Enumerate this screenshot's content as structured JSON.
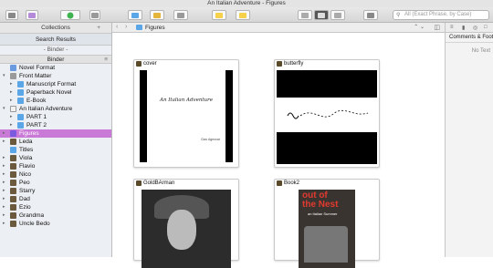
{
  "window_title": "An Italian Adventure - Figures",
  "toolbar": {
    "search_placeholder": "All (Exact Phrase, by Case)"
  },
  "sidebar": {
    "collections_label": "Collections",
    "search_results_label": "Search Results",
    "binder_tab_label": "- Binder -",
    "binder_label": "Binder",
    "tree": [
      {
        "label": "Novel Format",
        "depth": 0,
        "icon": "format",
        "arrow": ""
      },
      {
        "label": "Front Matter",
        "depth": 0,
        "icon": "folder-doc",
        "arrow": "▾"
      },
      {
        "label": "Manuscript Format",
        "depth": 1,
        "icon": "folder",
        "arrow": "▸"
      },
      {
        "label": "Paperback Novel",
        "depth": 1,
        "icon": "folder",
        "arrow": "▸"
      },
      {
        "label": "E-Book",
        "depth": 1,
        "icon": "folder",
        "arrow": "▸"
      },
      {
        "label": "An Italian Adventure",
        "depth": 0,
        "icon": "doc",
        "arrow": "▾"
      },
      {
        "label": "PART 1",
        "depth": 1,
        "icon": "folder",
        "arrow": "▸"
      },
      {
        "label": "PART 2",
        "depth": 1,
        "icon": "folder",
        "arrow": "▸"
      },
      {
        "label": "Figures",
        "depth": 0,
        "icon": "figures",
        "arrow": "▸",
        "selected": true
      },
      {
        "label": "Leda",
        "depth": 0,
        "icon": "person",
        "arrow": "▸"
      },
      {
        "label": "Titles",
        "depth": 0,
        "icon": "folder",
        "arrow": ""
      },
      {
        "label": "Viola",
        "depth": 0,
        "icon": "person",
        "arrow": "▸"
      },
      {
        "label": "Flavio",
        "depth": 0,
        "icon": "person",
        "arrow": "▸"
      },
      {
        "label": "Nico",
        "depth": 0,
        "icon": "person",
        "arrow": "▸"
      },
      {
        "label": "Peo",
        "depth": 0,
        "icon": "person",
        "arrow": "▸"
      },
      {
        "label": "Starry",
        "depth": 0,
        "icon": "person",
        "arrow": "▸"
      },
      {
        "label": "Dad",
        "depth": 0,
        "icon": "person",
        "arrow": "▸"
      },
      {
        "label": "Ezio",
        "depth": 0,
        "icon": "person",
        "arrow": "▸"
      },
      {
        "label": "Grandma",
        "depth": 0,
        "icon": "person",
        "arrow": "▸"
      },
      {
        "label": "Uncle Bedo",
        "depth": 0,
        "icon": "person",
        "arrow": "▸"
      }
    ]
  },
  "editor": {
    "breadcrumb": "Figures",
    "cards": [
      {
        "title": "cover",
        "cover_title": "An Italian Adventure",
        "author": "Ciao Ageovar"
      },
      {
        "title": "butterfly"
      },
      {
        "title": "GoldBArman"
      },
      {
        "title": "Book2",
        "book_title_line1": "out of",
        "book_title_line2": "the Nest",
        "book_subtitle": "an Italian Summer"
      }
    ]
  },
  "inspector": {
    "title": "Comments & Footnotes",
    "empty_text": "No Text"
  },
  "colors": {
    "selection": "#c97ad6",
    "folder": "#5aa6e6",
    "toolbar_bg": "#dcdcdc"
  }
}
